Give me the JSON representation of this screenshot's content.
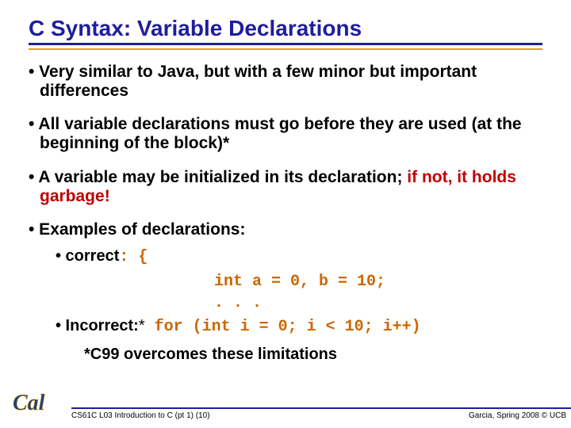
{
  "title": "C Syntax: Variable Declarations",
  "bullets": {
    "b1": "• Very similar to Java, but with a few minor but important differences",
    "b2": "• All variable declarations must go before they are used (at the beginning of the block)*",
    "b3a": "• A variable may be initialized in its declaration; ",
    "b3b": "if not, it holds garbage!",
    "b4": "• Examples of declarations:"
  },
  "sub": {
    "correct_label": "• correct",
    "correct_colon": ":",
    "code_open": " {",
    "code_line1": "int a = 0, b = 10;",
    "code_line2": ". . .",
    "incorrect_label": "• Incorrect:",
    "incorrect_star": "*",
    "code_incorrect": " for (int i = 0; i < 10; i++)"
  },
  "footnote": "*C99 overcomes these limitations",
  "footer": {
    "left": "CS61C L03 Introduction to C (pt 1) (10)",
    "right": "Garcia, Spring 2008 © UCB"
  },
  "logo_text": "Cal"
}
